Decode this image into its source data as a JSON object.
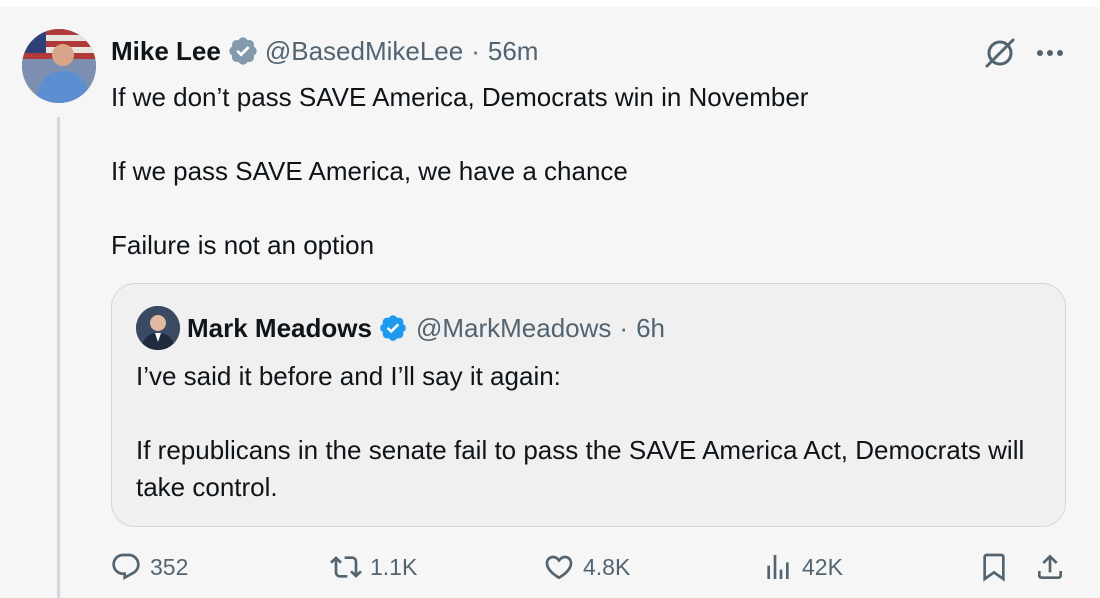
{
  "tweet": {
    "author": {
      "name": "Mike Lee",
      "handle": "@BasedMikeLee",
      "separator": "·",
      "time": "56m",
      "avatar_icon": "profile-photo-flag-background"
    },
    "body": [
      "If we don’t pass SAVE America, Democrats win in November",
      "If we pass SAVE America, we have a chance",
      "Failure is not an option"
    ],
    "icons": {
      "grok": "grok-slash-circle-icon",
      "more": "more-dots-icon"
    },
    "colors": {
      "gray_badge": "#829aab",
      "blue_badge": "#1d9bf0",
      "secondary_text": "#536471"
    }
  },
  "quote": {
    "author": {
      "name": "Mark Meadows",
      "handle": "@MarkMeadows",
      "separator": "·",
      "time": "6h"
    },
    "body": [
      "I’ve said it before and I’ll say it again:",
      "If republicans in the senate fail to pass the SAVE America Act, Democrats will take control."
    ]
  },
  "actions": {
    "replies": "352",
    "reposts": "1.1K",
    "likes": "4.8K",
    "views": "42K"
  }
}
